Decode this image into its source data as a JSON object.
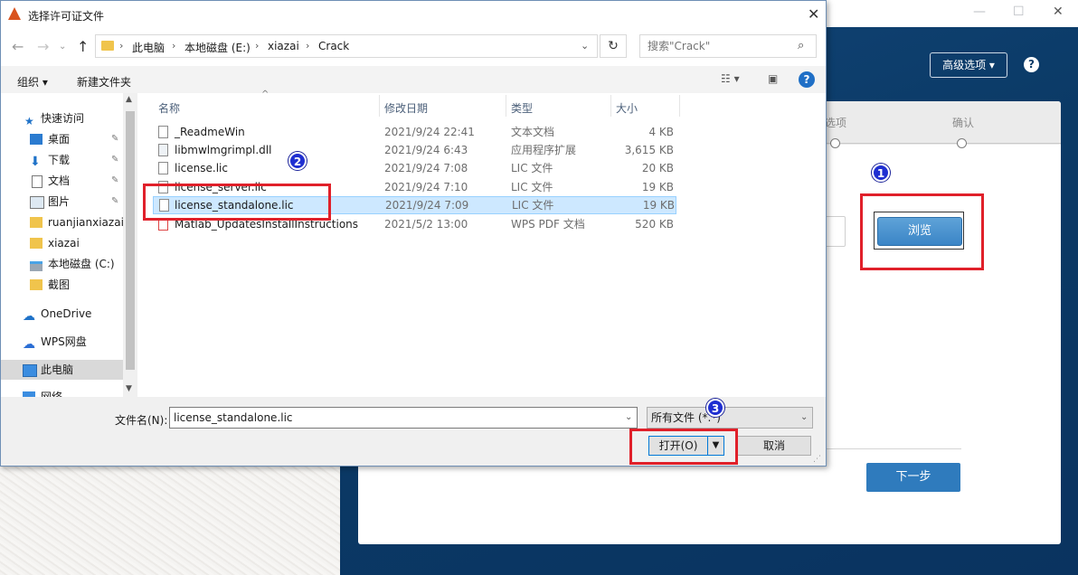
{
  "installer": {
    "advanced_options": "高级选项",
    "step_partial": "选项",
    "step_confirm": "确认",
    "browse": "浏览",
    "next": "下一步",
    "help": "?",
    "window_controls": {
      "minimize": "—",
      "maximize": "☐",
      "close": "✕"
    }
  },
  "dialog": {
    "title": "选择许可证文件",
    "close": "✕",
    "breadcrumb": [
      "此电脑",
      "本地磁盘 (E:)",
      "xiazai",
      "Crack"
    ],
    "search_placeholder": "搜索\"Crack\"",
    "toolbar": {
      "organize": "组织 ▾",
      "new_folder": "新建文件夹"
    },
    "nav": [
      {
        "label": "快速访问",
        "icon": "star-icon",
        "pinned": false
      },
      {
        "label": "桌面",
        "icon": "desktop-icon",
        "pinned": true
      },
      {
        "label": "下载",
        "icon": "download-icon",
        "pinned": true
      },
      {
        "label": "文档",
        "icon": "document-icon",
        "pinned": true
      },
      {
        "label": "图片",
        "icon": "picture-icon",
        "pinned": true
      },
      {
        "label": "ruanjianxiazai",
        "icon": "folder-icon",
        "pinned": false
      },
      {
        "label": "xiazai",
        "icon": "folder-icon",
        "pinned": false
      },
      {
        "label": "本地磁盘 (C:)",
        "icon": "drive-icon",
        "pinned": false
      },
      {
        "label": "截图",
        "icon": "folder-icon",
        "pinned": false
      },
      {
        "label": "OneDrive",
        "icon": "cloud-icon",
        "pinned": false
      },
      {
        "label": "WPS网盘",
        "icon": "cloud-icon",
        "pinned": false
      },
      {
        "label": "此电脑",
        "icon": "computer-icon",
        "pinned": false
      },
      {
        "label": "网络",
        "icon": "network-icon",
        "pinned": false
      }
    ],
    "columns": {
      "name": "名称",
      "date": "修改日期",
      "type": "类型",
      "size": "大小"
    },
    "files": [
      {
        "name": "_ReadmeWin",
        "date": "2021/9/24 22:41",
        "type": "文本文档",
        "size": "4 KB"
      },
      {
        "name": "libmwlmgrimpl.dll",
        "date": "2021/9/24 6:43",
        "type": "应用程序扩展",
        "size": "3,615 KB"
      },
      {
        "name": "license.lic",
        "date": "2021/9/24 7:08",
        "type": "LIC 文件",
        "size": "20 KB"
      },
      {
        "name": "license_server.lic",
        "date": "2021/9/24 7:10",
        "type": "LIC 文件",
        "size": "19 KB"
      },
      {
        "name": "license_standalone.lic",
        "date": "2021/9/24 7:09",
        "type": "LIC 文件",
        "size": "19 KB"
      },
      {
        "name": "Matlab_UpdatesInstallInstructions",
        "date": "2021/5/2 13:00",
        "type": "WPS PDF 文档",
        "size": "520 KB"
      }
    ],
    "filename_label": "文件名(N):",
    "filename_value": "license_standalone.lic",
    "filter": "所有文件 (*.*)",
    "open": "打开(O)",
    "cancel": "取消"
  },
  "badges": [
    "1",
    "2",
    "3"
  ],
  "colors": {
    "installer_bg": "#0b3a66",
    "highlight_red": "#e0202a",
    "badge_blue": "#1f2fd1",
    "selected_row": "#cde8ff"
  }
}
